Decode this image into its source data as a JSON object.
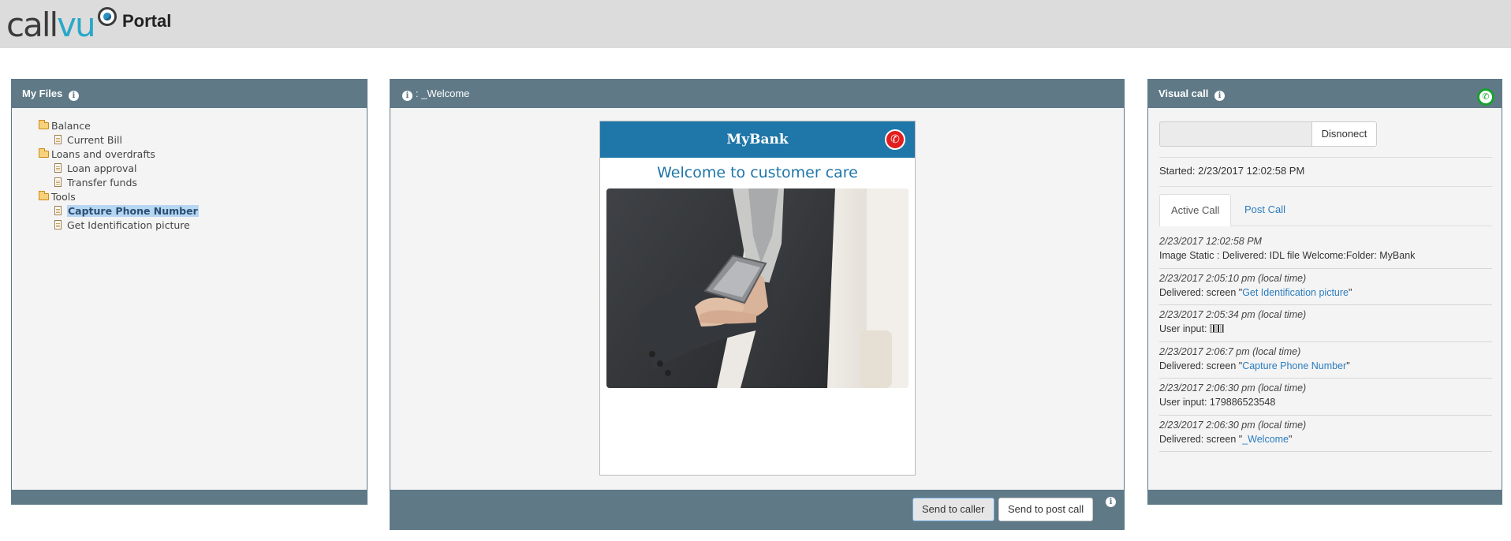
{
  "header": {
    "logo_part1": "call",
    "logo_part2": "vu",
    "title": "Portal"
  },
  "files_panel": {
    "title": "My Files",
    "tree": [
      {
        "type": "folder",
        "label": "Balance"
      },
      {
        "type": "file",
        "label": "Current Bill"
      },
      {
        "type": "folder",
        "label": "Loans and overdrafts"
      },
      {
        "type": "file",
        "label": "Loan approval"
      },
      {
        "type": "file",
        "label": "Transfer funds"
      },
      {
        "type": "folder",
        "label": "Tools"
      },
      {
        "type": "file",
        "label": "Capture Phone Number",
        "selected": true
      },
      {
        "type": "file",
        "label": "Get Identification picture"
      }
    ]
  },
  "main_panel": {
    "title": ": _Welcome",
    "phone": {
      "brand": "MyBank",
      "welcome": "Welcome to customer care"
    },
    "send_to_caller_label": "Send to caller",
    "send_to_post_call_label": "Send to post call"
  },
  "call_panel": {
    "title": "Visual call",
    "input_value": "",
    "disconnect_label": "Disnonect",
    "started": "Started: 2/23/2017 12:02:58 PM",
    "tabs": [
      {
        "label": "Active Call",
        "active": true
      },
      {
        "label": "Post Call",
        "active": false
      }
    ],
    "log": [
      {
        "time": "2/23/2017 12:02:58 PM",
        "message": "Image Static : Delivered: IDL file Welcome:Folder: MyBank"
      },
      {
        "time": "2/23/2017 2:05:10 pm (local time)",
        "prefix": "Delivered: screen \"",
        "link": "Get Identification picture",
        "suffix": "\""
      },
      {
        "time": "2/23/2017 2:05:34 pm (local time)",
        "message": "User input: "
      },
      {
        "time": "2/23/2017 2:06:7 pm (local time)",
        "prefix": "Delivered: screen \"",
        "link": "Capture Phone Number",
        "suffix": "\""
      },
      {
        "time": "2/23/2017 2:06:30 pm (local time)",
        "message": "User input: 179886523548"
      },
      {
        "time": "2/23/2017 2:06:30 pm (local time)",
        "prefix": "Delivered: screen \"",
        "link": "_Welcome",
        "suffix": "\""
      }
    ]
  },
  "colors": {
    "panel_header": "#5f7987",
    "brand_blue": "#1f76a8",
    "logo_teal": "#29a8c9",
    "link": "#2a7dc0",
    "hangup_red": "#e21d1d",
    "call_green": "#17a22e"
  },
  "icons": {
    "info": "info-icon",
    "folder": "folder-open-icon",
    "file": "file-icon",
    "hangup": "phone-hangup-icon",
    "call_status": "phone-call-icon"
  }
}
